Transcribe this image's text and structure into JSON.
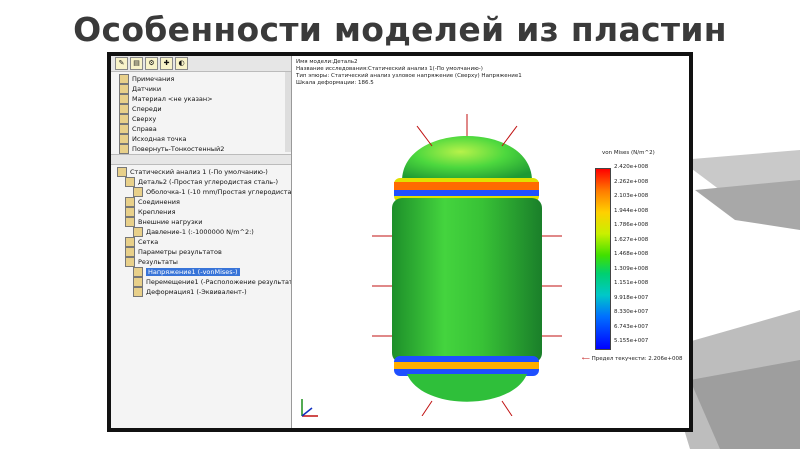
{
  "slide": {
    "title": "Особенности моделей из пластин"
  },
  "tree_top": [
    {
      "label": "Примечания"
    },
    {
      "label": "Датчики"
    },
    {
      "label": "Материал <не указан>"
    },
    {
      "label": "Спереди"
    },
    {
      "label": "Сверху"
    },
    {
      "label": "Справа"
    },
    {
      "label": "Исходная точка"
    },
    {
      "label": "Повернуть-Тонкостенный2"
    }
  ],
  "tree_bottom": [
    {
      "label": "Статический анализ 1 (-По умолчанию-)",
      "indent": 0
    },
    {
      "label": "Деталь2 (-Простая углеродистая сталь-)",
      "indent": 1
    },
    {
      "label": "Оболочка-1 (-10 mm/Простая углеродистая",
      "indent": 2
    },
    {
      "label": "Соединения",
      "indent": 1
    },
    {
      "label": "Крепления",
      "indent": 1
    },
    {
      "label": "Внешние нагрузки",
      "indent": 1
    },
    {
      "label": "Давление-1 (:-1000000 N/m^2:)",
      "indent": 2
    },
    {
      "label": "Сетка",
      "indent": 1
    },
    {
      "label": "Параметры результатов",
      "indent": 1
    },
    {
      "label": "Результаты",
      "indent": 1
    },
    {
      "label": "Напряжение1 (-vonMises-)",
      "indent": 2,
      "selected": true
    },
    {
      "label": "Перемещение1 (-Расположение результата",
      "indent": 2
    },
    {
      "label": "Деформация1 (-Эквивалент-)",
      "indent": 2
    }
  ],
  "info": {
    "line1": "Имя модели:Деталь2",
    "line2": "Название исследования:Статический анализ 1(-По умолчанию-)",
    "line3": "Тип эпюры: Статический анализ узловое напряжение (Сверху) Напряжение1",
    "line4": "Шкала деформации: 186.5"
  },
  "legend": {
    "title": "von Mises (N/m^2)",
    "values": [
      "2.420e+008",
      "2.262e+008",
      "2.103e+008",
      "1.944e+008",
      "1.786e+008",
      "1.627e+008",
      "1.468e+008",
      "1.309e+008",
      "1.151e+008",
      "9.918e+007",
      "8.330e+007",
      "6.743e+007",
      "5.155e+007"
    ],
    "yield": "Предел текучести: 2.206e+008"
  },
  "colors": {
    "frame": "#111111",
    "accent": "#3874d8",
    "model_green": "#2fbf3a"
  }
}
